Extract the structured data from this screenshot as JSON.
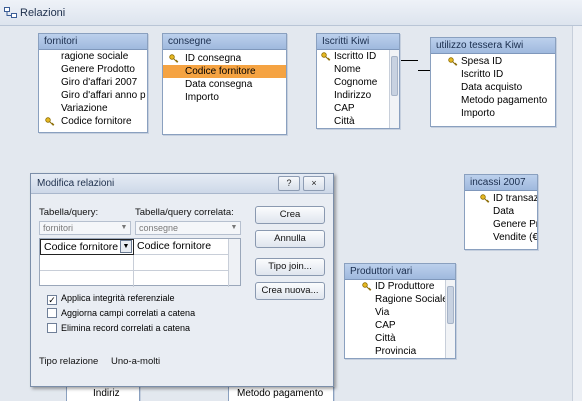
{
  "window": {
    "title": "Relazioni"
  },
  "tables": {
    "fornitori": {
      "name": "fornitori",
      "fields": [
        "ragione sociale",
        "Genere Prodotto",
        "Giro d'affari 2007",
        "Giro d'affari anno p",
        "Variazione",
        "Codice fornitore"
      ]
    },
    "consegne": {
      "name": "consegne",
      "fields": [
        "ID consegna",
        "Codice fornitore",
        "Data consegna",
        "Importo"
      ]
    },
    "iscritti": {
      "name": "Iscritti Kiwi",
      "fields": [
        "Iscritto ID",
        "Nome",
        "Cognome",
        "Indirizzo",
        "CAP",
        "Città"
      ]
    },
    "utilizzo": {
      "name": "utilizzo tessera Kiwi",
      "fields": [
        "Spesa ID",
        "Iscritto ID",
        "Data acquisto",
        "Metodo pagamento",
        "Importo"
      ]
    },
    "incassi": {
      "name": "incassi 2007",
      "fields": [
        "ID transaz",
        "Data",
        "Genere Pr",
        "Vendite (€"
      ]
    },
    "produttori": {
      "name": "Produttori vari",
      "fields": [
        "ID Produttore",
        "Ragione Sociale",
        "Via",
        "CAP",
        "Città",
        "Provincia"
      ]
    },
    "hidden_bottom": {
      "indirizzo": "Indiriz",
      "metodo": "Metodo pagamento"
    }
  },
  "dialog": {
    "title": "Modifica relazioni",
    "help": "?",
    "close": "×",
    "table_label": "Tabella/query:",
    "related_label": "Tabella/query correlata:",
    "table_value": "fornitori",
    "related_value": "consegne",
    "field_left": "Codice fornitore",
    "field_right": "Codice fornitore",
    "buttons": {
      "create": "Crea",
      "cancel": "Annulla",
      "join": "Tipo join...",
      "new": "Crea nuova..."
    },
    "checks": [
      {
        "label": "Applica integrità referenziale",
        "checked": true
      },
      {
        "label": "Aggiorna campi correlati a catena",
        "checked": false
      },
      {
        "label": "Elimina record correlati a catena",
        "checked": false
      }
    ],
    "rel_type_label": "Tipo relazione",
    "rel_type_value": "Uno-a-molti"
  }
}
